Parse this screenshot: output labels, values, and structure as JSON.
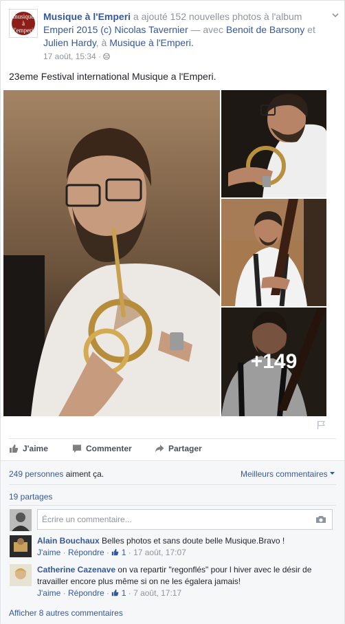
{
  "post": {
    "page_name": "Musique à l'Emperi",
    "logo_text_1": "musique à",
    "logo_text_2": "l'emperi",
    "action_1": "a ajouté 152 nouvelles photos à l'album",
    "album": "Emperi 2015 (c) Nicolas Tavernier",
    "action_2": "— avec",
    "tag_1": "Benoit de Barsony",
    "action_3": "et",
    "tag_2": "Julien Hardy",
    "action_4": ", à",
    "place": "Musique à l'Emperi.",
    "timestamp": "17 août, 15:34",
    "dot": "·",
    "status": "23eme Festival international Musique a l'Emperi.",
    "more_photos": "+149"
  },
  "actions": {
    "like": "J'aime",
    "comment": "Commenter",
    "share": "Partager"
  },
  "ufi": {
    "likes_count": "249 personnes",
    "likes_suffix": "aiment ça.",
    "sort": "Meilleurs commentaires",
    "shares": "19 partages",
    "comment_placeholder": "Écrire un commentaire...",
    "comments": [
      {
        "author": "Alain Bouchaux",
        "text": "Belles photos et sans doute belle Musique.Bravo !",
        "like": "J'aime",
        "reply": "Répondre",
        "likes": "1",
        "time": "17 août, 17:07"
      },
      {
        "author": "Catherine Cazenave",
        "text": "on va repartir \"regonflés\" pour l hiver avec le désir de travailler encore plus même si on ne les égalera jamais!",
        "like": "J'aime",
        "reply": "Répondre",
        "likes": "1",
        "time": "7 août, 17:17"
      }
    ],
    "more_comments": "Afficher 8 autres commentaires"
  },
  "icons": [
    "globe-icon",
    "chevron-down-icon",
    "flag-icon",
    "like-icon",
    "comment-icon",
    "share-icon",
    "camera-icon",
    "thumbs-up-icon"
  ],
  "colors": {
    "link": "#365899",
    "muted": "#90949c",
    "ufi_bg": "#f6f7f9"
  }
}
